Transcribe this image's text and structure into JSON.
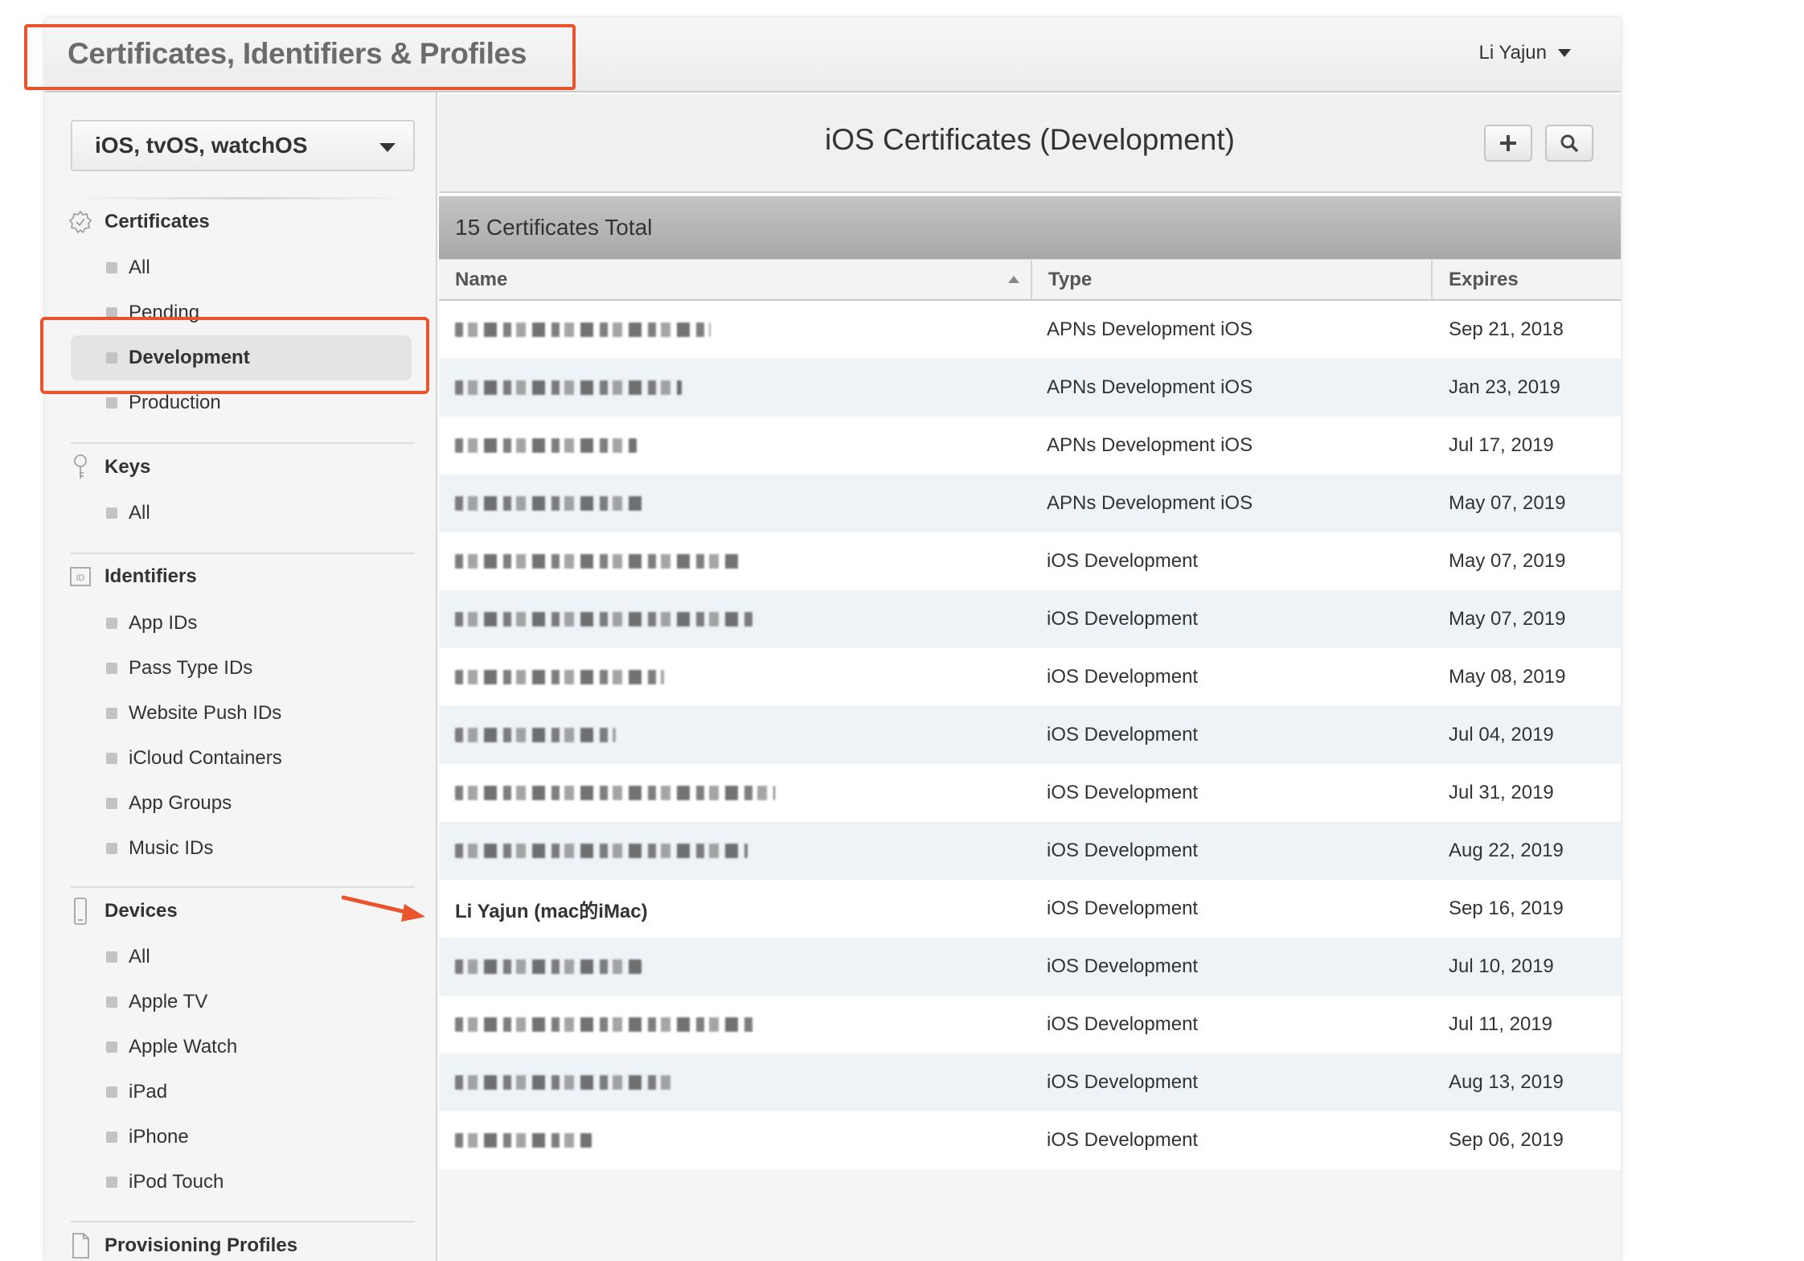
{
  "header": {
    "site_title": "Certificates, Identifiers & Profiles",
    "user_name": "Li Yajun"
  },
  "sidebar": {
    "platform": "iOS, tvOS, watchOS",
    "sections": {
      "certificates": {
        "label": "Certificates",
        "items": [
          "All",
          "Pending",
          "Development",
          "Production"
        ],
        "active": "Development"
      },
      "keys": {
        "label": "Keys",
        "items": [
          "All"
        ]
      },
      "identifiers": {
        "label": "Identifiers",
        "items": [
          "App IDs",
          "Pass Type IDs",
          "Website Push IDs",
          "iCloud Containers",
          "App Groups",
          "Music IDs"
        ]
      },
      "devices": {
        "label": "Devices",
        "items": [
          "All",
          "Apple TV",
          "Apple Watch",
          "iPad",
          "iPhone",
          "iPod Touch"
        ]
      },
      "profiles": {
        "label": "Provisioning Profiles"
      }
    }
  },
  "main": {
    "title": "iOS Certificates (Development)",
    "count_label": "15 Certificates Total",
    "columns": {
      "name": "Name",
      "type": "Type",
      "expires": "Expires"
    },
    "rows": [
      {
        "name": "",
        "type": "APNs Development iOS",
        "expires": "Sep 21, 2018"
      },
      {
        "name": "",
        "type": "APNs Development iOS",
        "expires": "Jan 23, 2019"
      },
      {
        "name": "",
        "type": "APNs Development iOS",
        "expires": "Jul 17, 2019"
      },
      {
        "name": "",
        "type": "APNs Development iOS",
        "expires": "May 07, 2019"
      },
      {
        "name": "",
        "type": "iOS Development",
        "expires": "May 07, 2019"
      },
      {
        "name": "",
        "type": "iOS Development",
        "expires": "May 07, 2019"
      },
      {
        "name": "",
        "type": "iOS Development",
        "expires": "May 08, 2019"
      },
      {
        "name": "",
        "type": "iOS Development",
        "expires": "Jul 04, 2019"
      },
      {
        "name": "",
        "type": "iOS Development",
        "expires": "Jul 31, 2019"
      },
      {
        "name": "",
        "type": "iOS Development",
        "expires": "Aug 22, 2019"
      },
      {
        "name": "Li Yajun (mac的iMac)",
        "type": "iOS Development",
        "expires": "Sep 16, 2019"
      },
      {
        "name": "",
        "type": "iOS Development",
        "expires": "Jul 10, 2019"
      },
      {
        "name": "",
        "type": "iOS Development",
        "expires": "Jul 11, 2019"
      },
      {
        "name": "",
        "type": "iOS Development",
        "expires": "Aug 13, 2019"
      },
      {
        "name": "",
        "type": "iOS Development",
        "expires": "Sep 06, 2019"
      }
    ]
  },
  "colors": {
    "annotation": "#e9542c",
    "row_alt": "#eef3f8",
    "count_bar": "#b4b4b4"
  },
  "icons": [
    "certificate-badge-icon",
    "key-icon",
    "id-card-icon",
    "device-phone-icon",
    "document-icon",
    "plus-icon",
    "search-icon",
    "caret-down-icon",
    "sort-ascending-icon",
    "annotation-arrow-icon"
  ]
}
